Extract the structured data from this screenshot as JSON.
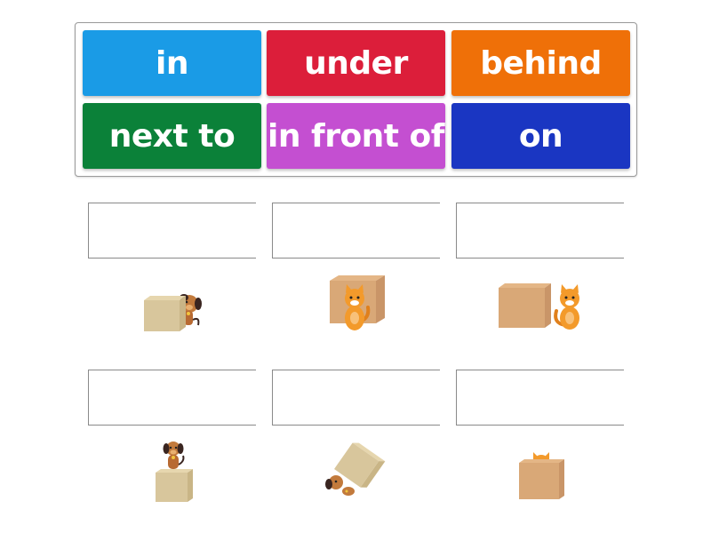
{
  "word_bank": {
    "tiles": [
      {
        "label": "in",
        "color": "#1a9be6"
      },
      {
        "label": "under",
        "color": "#dc1e3a"
      },
      {
        "label": "behind",
        "color": "#ef7008"
      },
      {
        "label": "next to",
        "color": "#0b8139"
      },
      {
        "label": "in front of",
        "color": "#c44fd1"
      },
      {
        "label": "on",
        "color": "#1a36c2"
      }
    ]
  },
  "slots": [
    {
      "answer": "",
      "picture": "dog-behind-box"
    },
    {
      "answer": "",
      "picture": "cat-in-front-of-box"
    },
    {
      "answer": "",
      "picture": "cat-next-to-box"
    },
    {
      "answer": "",
      "picture": "dog-on-box"
    },
    {
      "answer": "",
      "picture": "dog-under-box"
    },
    {
      "answer": "",
      "picture": "cat-in-box"
    }
  ],
  "colors": {
    "box_tan": "#d8c69c",
    "box_brown": "#d9a877",
    "cat_orange": "#f39a2b",
    "dog_brown": "#b86a32"
  }
}
